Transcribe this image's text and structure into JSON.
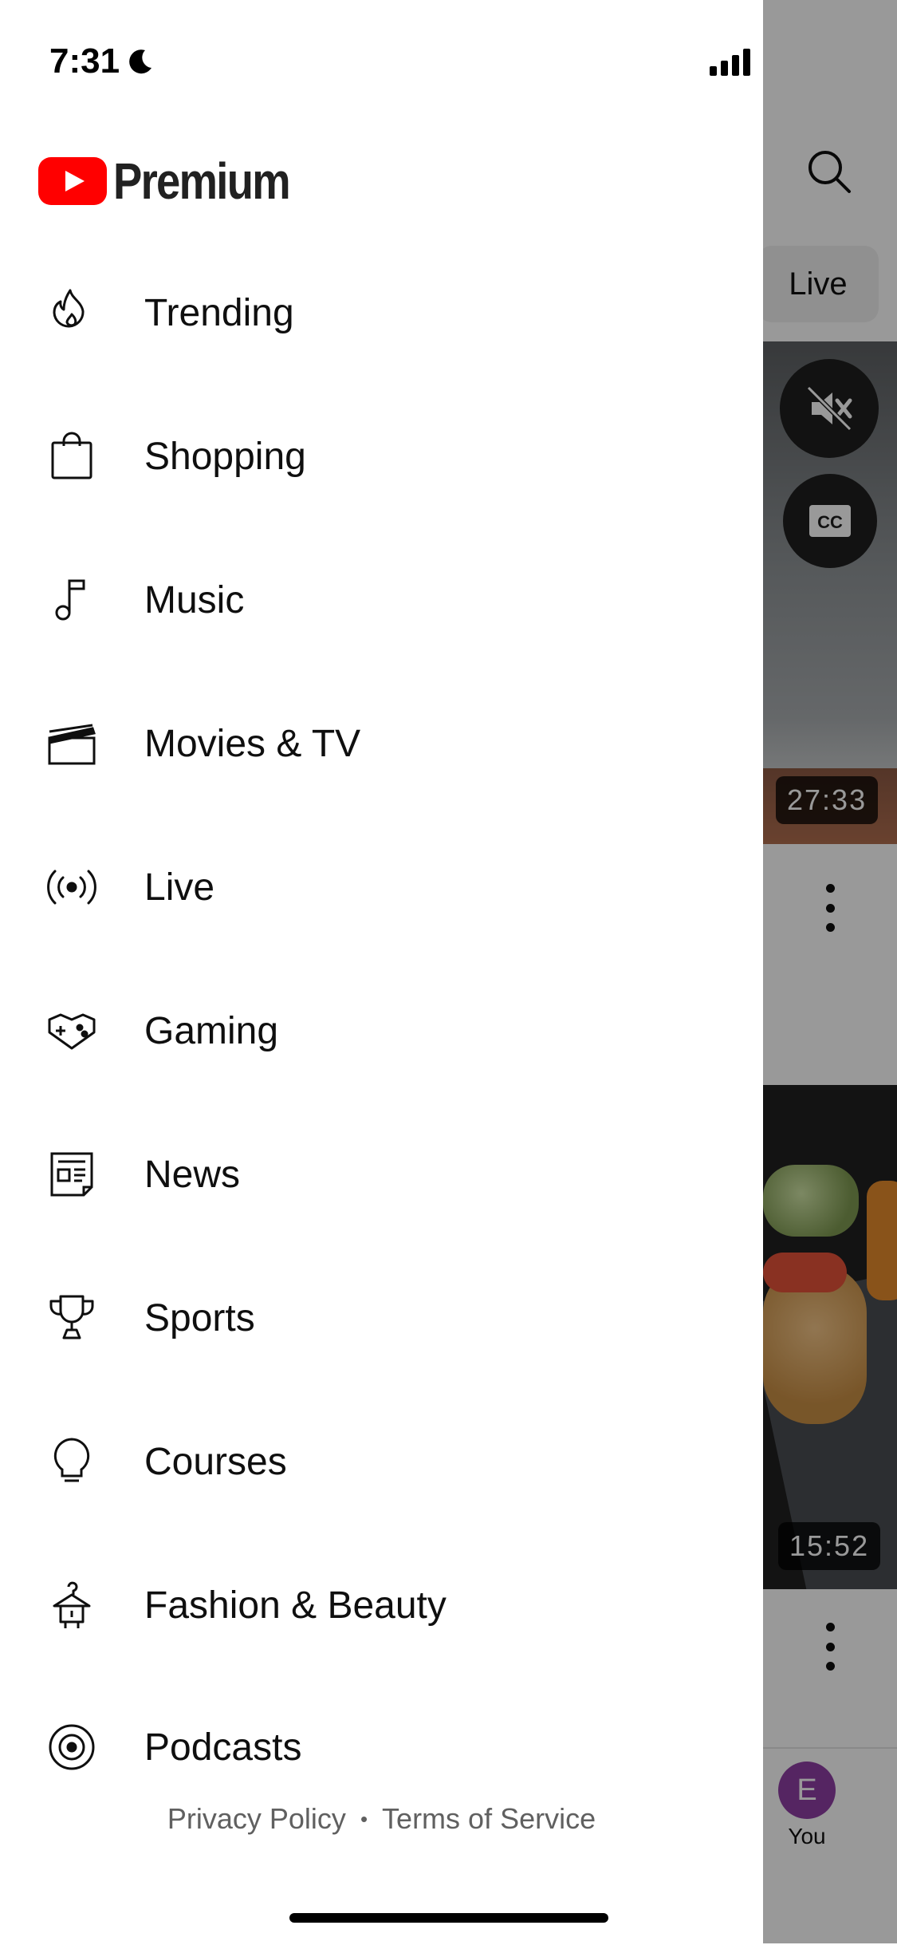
{
  "status_bar": {
    "time": "7:31"
  },
  "header": {
    "brand_word": "Premium"
  },
  "menu": {
    "items": [
      {
        "label": "Trending",
        "icon": "flame-icon"
      },
      {
        "label": "Shopping",
        "icon": "shopping-bag-icon"
      },
      {
        "label": "Music",
        "icon": "music-note-icon"
      },
      {
        "label": "Movies & TV",
        "icon": "clapperboard-icon"
      },
      {
        "label": "Live",
        "icon": "broadcast-icon"
      },
      {
        "label": "Gaming",
        "icon": "gamepad-icon"
      },
      {
        "label": "News",
        "icon": "newspaper-icon"
      },
      {
        "label": "Sports",
        "icon": "trophy-icon"
      },
      {
        "label": "Courses",
        "icon": "lightbulb-icon"
      },
      {
        "label": "Fashion & Beauty",
        "icon": "hanger-icon"
      },
      {
        "label": "Podcasts",
        "icon": "podcast-icon"
      }
    ]
  },
  "footer": {
    "privacy": "Privacy Policy",
    "separator": "•",
    "terms": "Terms of Service"
  },
  "background": {
    "chip_label": "Live",
    "video1_duration": "27:33",
    "video2_duration": "15:52",
    "avatar_initial": "E",
    "you_label": "You"
  },
  "colors": {
    "brand_red": "#ff0000",
    "avatar": "#8e3fa3",
    "text": "#0f0f0f",
    "secondary": "#606060"
  }
}
